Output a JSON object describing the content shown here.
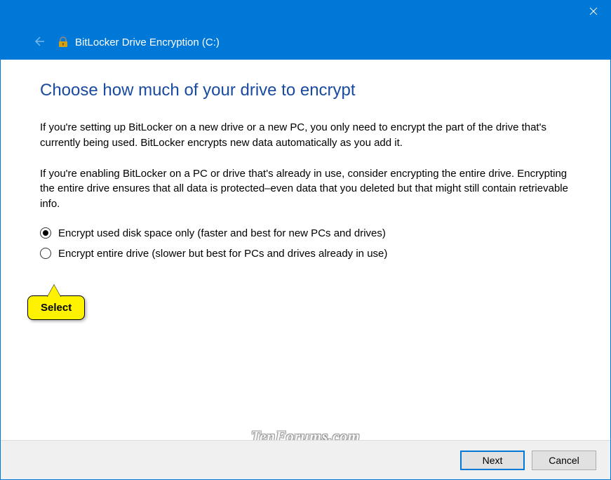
{
  "titlebar": {
    "title": "BitLocker Drive Encryption (C:)"
  },
  "content": {
    "heading": "Choose how much of your drive to encrypt",
    "paragraph1": "If you're setting up BitLocker on a new drive or a new PC, you only need to encrypt the part of the drive that's currently being used. BitLocker encrypts new data automatically as you add it.",
    "paragraph2": "If you're enabling BitLocker on a PC or drive that's already in use, consider encrypting the entire drive. Encrypting the entire drive ensures that all data is protected–even data that you deleted but that might still contain retrievable info."
  },
  "radios": {
    "option1": "Encrypt used disk space only (faster and best for new PCs and drives)",
    "option2": "Encrypt entire drive (slower but best for PCs and drives already in use)"
  },
  "callout": {
    "text": "Select"
  },
  "footer": {
    "next": "Next",
    "cancel": "Cancel"
  },
  "watermark": "TenForums.com"
}
